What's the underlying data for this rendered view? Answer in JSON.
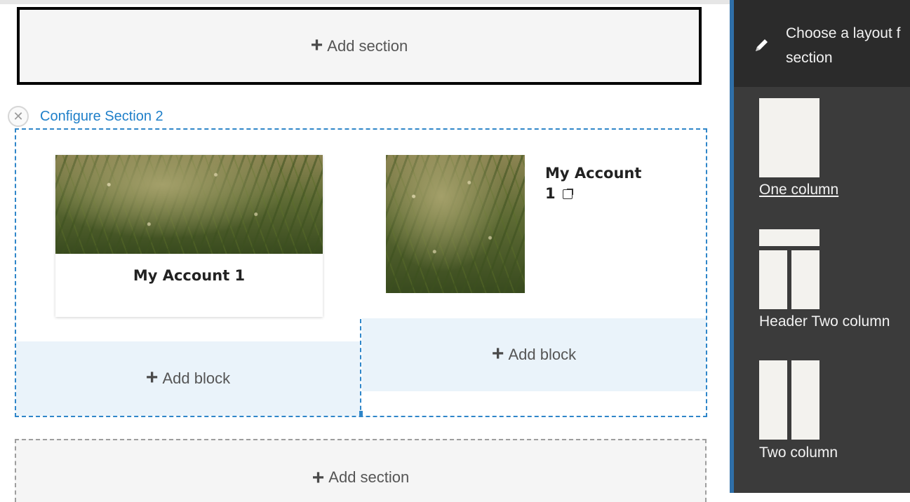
{
  "canvas": {
    "add_section_top": {
      "label": "Add section"
    },
    "configure_section": {
      "link_text": "Configure Section 2"
    },
    "card": {
      "title": "My Account 1"
    },
    "media": {
      "title_line1": "My Account",
      "title_line2": "1"
    },
    "add_block_left": {
      "label": "Add block"
    },
    "add_block_right": {
      "label": "Add block"
    },
    "add_section_bottom": {
      "label": "Add section"
    }
  },
  "sidebar": {
    "title": "Choose a layout f",
    "title_line2": "section",
    "layouts": [
      {
        "label": "One column",
        "selected": true
      },
      {
        "label": "Header Two column"
      },
      {
        "label": "Two column"
      }
    ]
  },
  "icons": {
    "plus": "+",
    "close": "✕",
    "pencil": "pencil-icon",
    "external": "external-link-icon"
  },
  "colors": {
    "link_blue": "#1e7fc9",
    "section_border": "#2f86c9",
    "add_block_bg": "#eaf3fa",
    "sidebar_bg": "#3b3b3b",
    "sidebar_header_bg": "#2b2b2b"
  }
}
